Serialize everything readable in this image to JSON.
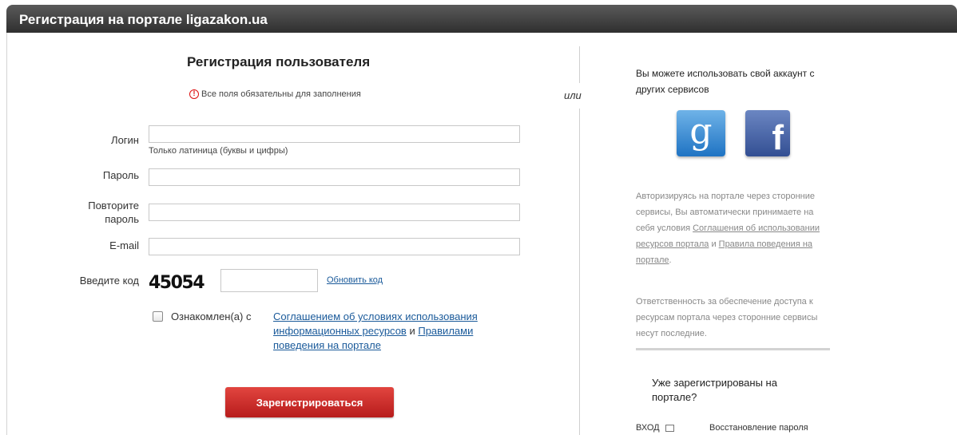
{
  "header": {
    "title": "Регистрация на портале ligazakon.ua"
  },
  "separator": {
    "or": "или"
  },
  "form": {
    "title": "Регистрация пользователя",
    "required_note": "Все поля обязательны для заполнения",
    "login_label": "Логин",
    "login_hint": "Только латиница (буквы и цифры)",
    "password_label": "Пароль",
    "repeat_label_1": "Повторите",
    "repeat_label_2": "пароль",
    "email_label": "E-mail",
    "code_label": "Введите код",
    "captcha_text": "45054",
    "refresh_label": "Обновить код",
    "agree_label": "Ознакомлен(а) с",
    "agree_link_1": "Соглашением об условиях использования информационных ресурсов",
    "agree_and": " и ",
    "agree_link_2": "Правилами поведения на портале",
    "submit_label": "Зарегистрироваться"
  },
  "social": {
    "title": "Вы можете использовать свой аккаунт с других сервисов",
    "google_glyph": "g",
    "facebook_glyph": "f",
    "note_part1": "Авторизируясь на портале через сторонние сервисы, Вы автоматически принимаете на себя условия ",
    "note_link1": "Соглашения об использовании ресурсов портала",
    "note_and": " и ",
    "note_link2": "Правила поведения на портале",
    "note_end": ".",
    "responsibility": "Ответственность за обеспечение доступа к ресурсам портала через сторонние сервисы несут последние.",
    "already_registered": "Уже зарегистрированы на портале?",
    "login_link": "ВХОД",
    "restore_link": "Восстановление пароля"
  }
}
